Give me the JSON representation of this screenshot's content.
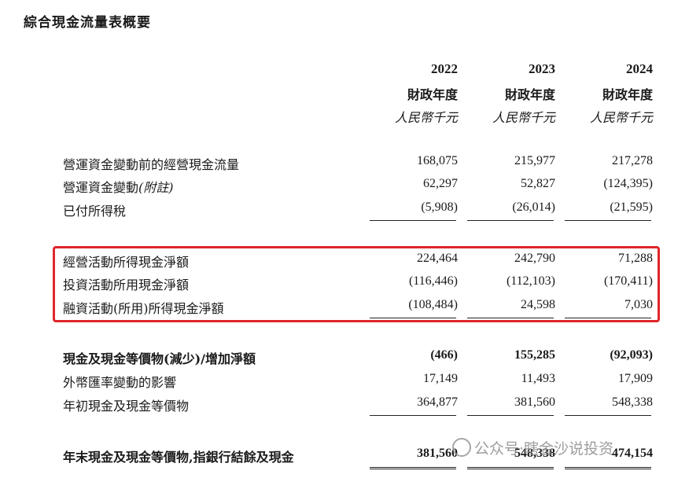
{
  "title": "綜合現金流量表概要",
  "columns": [
    {
      "year": "2022",
      "fy": "財政年度",
      "unit": "人民幣千元"
    },
    {
      "year": "2023",
      "fy": "財政年度",
      "unit": "人民幣千元"
    },
    {
      "year": "2024",
      "fy": "財政年度",
      "unit": "人民幣千元"
    }
  ],
  "rows": [
    {
      "label_a": "營運資金變動前的經營現金流量",
      "label_b": "",
      "values": [
        "168,075",
        "215,977",
        "217,278"
      ]
    },
    {
      "label_a": "營運資金變動",
      "label_b": "(附註)",
      "values": [
        "62,297",
        "52,827",
        "(124,395)"
      ]
    },
    {
      "label_a": "已付所得稅",
      "label_b": "",
      "values": [
        "(5,908)",
        "(26,014)",
        "(21,595)"
      ]
    },
    {
      "label_a": "經營活動所得現金淨額",
      "label_b": "",
      "values": [
        "224,464",
        "242,790",
        "71,288"
      ]
    },
    {
      "label_a": "投資活動所用現金淨額",
      "label_b": "",
      "values": [
        "(116,446)",
        "(112,103)",
        "(170,411)"
      ]
    },
    {
      "label_a": "融資活動(所用)所得現金淨額",
      "label_b": "",
      "values": [
        "(108,484)",
        "24,598",
        "7,030"
      ]
    },
    {
      "label_a": "現金及現金等價物(減少)/增加淨額",
      "label_b": "",
      "values": [
        "(466)",
        "155,285",
        "(92,093)"
      ]
    },
    {
      "label_a": "外幣匯率變動的影響",
      "label_b": "",
      "values": [
        "17,149",
        "11,493",
        "17,909"
      ]
    },
    {
      "label_a": "年初現金及現金等價物",
      "label_b": "",
      "values": [
        "364,877",
        "381,560",
        "548,338"
      ]
    },
    {
      "label_a": "年末現金及現金等價物,指銀行結餘及現金",
      "label_b": "",
      "values": [
        "381,560",
        "548,338",
        "474,154"
      ]
    }
  ],
  "watermark": "公众号·瞎金沙说投资",
  "highlight_color": "#e0262b"
}
